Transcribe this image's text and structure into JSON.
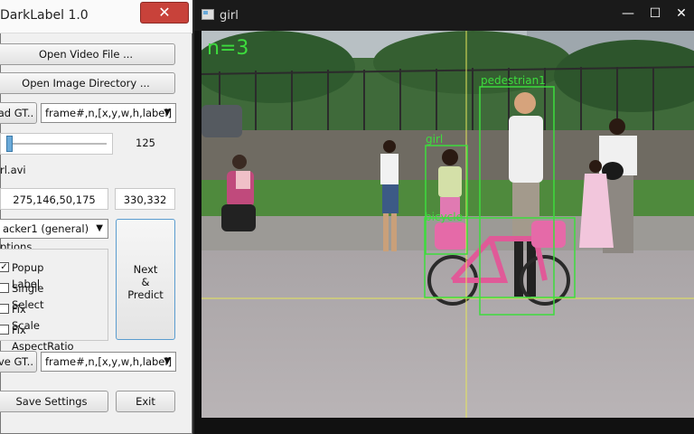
{
  "left_window": {
    "title": "DarkLabel 1.0",
    "close_label": "✕",
    "open_video_label": "Open Video File ...",
    "open_image_dir_label": "Open Image Directory ...",
    "load_gt_label": "ad GT..",
    "load_format": "frame#,n,[x,y,w,h,label]",
    "frame_value": "125",
    "file_name": "rl.avi",
    "bbox_value": "275,146,50,175",
    "mouse_value": "330,332",
    "tracker": "acker1 (general)",
    "options_title": "ptions",
    "options": [
      {
        "label": "Popup Label",
        "checked": true
      },
      {
        "label": "Single Select",
        "checked": false
      },
      {
        "label": "Fix Scale",
        "checked": false
      },
      {
        "label": "Fix AspectRatio",
        "checked": false
      }
    ],
    "next_predict_lines": [
      "Next",
      "&",
      "Predict"
    ],
    "save_gt_label": "ve GT..",
    "save_format": "frame#,n,[x,y,w,h,label]",
    "save_settings_label": "Save Settings",
    "exit_label": "Exit",
    "slider_fraction": 0.02
  },
  "video_window": {
    "title": "girl",
    "minimize_label": "—",
    "maximize_label": "☐",
    "close_label": "✕",
    "overlay_count": "n=3",
    "labels": {
      "pedestrian": "pedestrian1",
      "girl": "girl",
      "bicycle": "bicycle"
    }
  },
  "colors": {
    "box": "#3ddc3d",
    "crosshair": "#e6e65a",
    "accent": "#6aa9d8"
  }
}
